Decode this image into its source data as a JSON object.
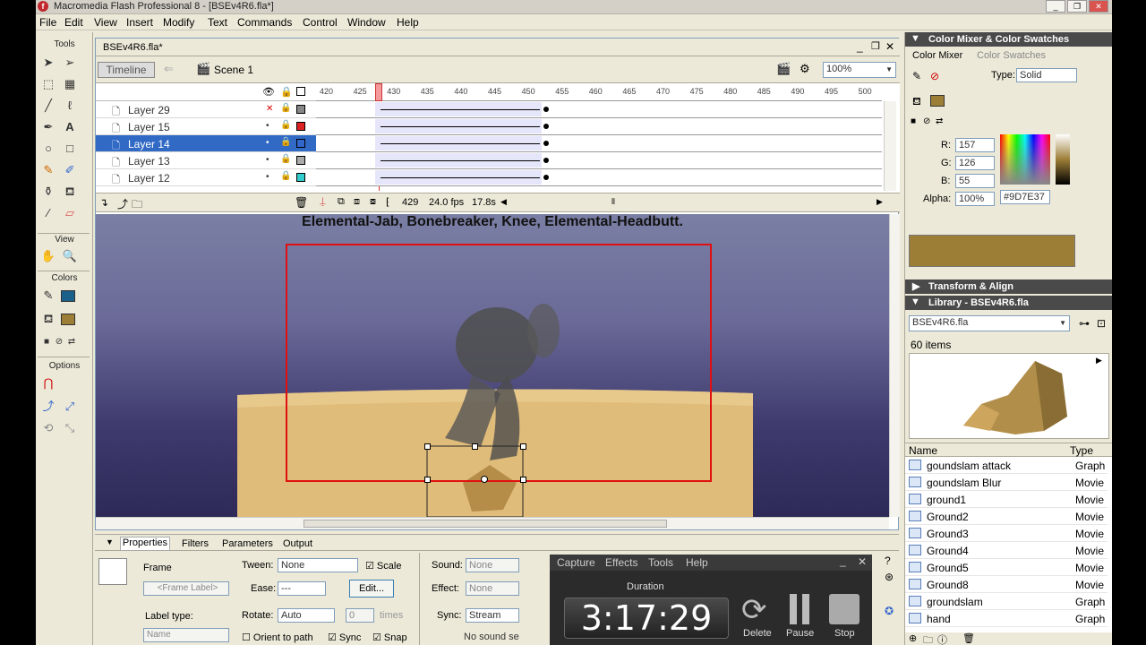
{
  "window": {
    "title": "Macromedia Flash Professional 8 - [BSEv4R6.fla*]"
  },
  "menu": [
    "File",
    "Edit",
    "View",
    "Insert",
    "Modify",
    "Text",
    "Commands",
    "Control",
    "Window",
    "Help"
  ],
  "tools_panel": {
    "title": "Tools",
    "view": "View",
    "colors": "Colors",
    "options": "Options"
  },
  "document": {
    "tab": "BSEv4R6.fla*",
    "timeline_button": "Timeline",
    "scene": "Scene 1",
    "zoom": "100%",
    "ruler": [
      "420",
      "425",
      "430",
      "435",
      "440",
      "445",
      "450",
      "455",
      "460",
      "465",
      "470",
      "475",
      "480",
      "485",
      "490",
      "495",
      "500"
    ],
    "layers": [
      {
        "name": "Layer 29",
        "selected": false
      },
      {
        "name": "Layer 15",
        "selected": false
      },
      {
        "name": "Layer 14",
        "selected": true
      },
      {
        "name": "Layer 13",
        "selected": false
      },
      {
        "name": "Layer 12",
        "selected": false
      }
    ],
    "frame": "429",
    "fps": "24.0 fps",
    "time": "17.8s",
    "stage_text": "Elemental-Jab, Bonebreaker, Knee, Elemental-Headbutt."
  },
  "properties": {
    "tabs": [
      "Properties",
      "Filters",
      "Parameters",
      "Output"
    ],
    "frame_label": "Frame",
    "frame_placeholder": "<Frame Label>",
    "label_type": "Label type:",
    "label_type_value": "Name",
    "tween_label": "Tween:",
    "tween_value": "None",
    "scale": "Scale",
    "ease_label": "Ease:",
    "ease_value": "---",
    "edit_button": "Edit...",
    "rotate_label": "Rotate:",
    "rotate_value": "Auto",
    "rotate_times": "0",
    "times": "times",
    "orient": "Orient to path",
    "sync": "Sync",
    "snap": "Snap",
    "sound_label": "Sound:",
    "sound_value": "None",
    "effect_label": "Effect:",
    "effect_value": "None",
    "sync_label": "Sync:",
    "sync_value": "Stream",
    "no_sound": "No sound se"
  },
  "capture": {
    "menu": [
      "Capture",
      "Effects",
      "Tools",
      "Help"
    ],
    "duration_label": "Duration",
    "duration": "3:17:29",
    "delete": "Delete",
    "pause": "Pause",
    "stop": "Stop"
  },
  "color_mixer": {
    "header": "Color Mixer & Color Swatches",
    "tab1": "Color Mixer",
    "tab2": "Color Swatches",
    "type_label": "Type:",
    "type_value": "Solid",
    "r_label": "R:",
    "r": "157",
    "g_label": "G:",
    "g": "126",
    "b_label": "B:",
    "b": "55",
    "alpha_label": "Alpha:",
    "alpha": "100%",
    "hex": "#9D7E37",
    "swatch_color": "#9D7E37"
  },
  "transform": {
    "header": "Transform & Align"
  },
  "library": {
    "header": "Library - BSEv4R6.fla",
    "file": "BSEv4R6.fla",
    "count": "60 items",
    "col_name": "Name",
    "col_type": "Type",
    "items": [
      {
        "name": "goundslam attack",
        "type": "Graph"
      },
      {
        "name": "goundslam Blur",
        "type": "Movie"
      },
      {
        "name": "ground1",
        "type": "Movie"
      },
      {
        "name": "Ground2",
        "type": "Movie"
      },
      {
        "name": "Ground3",
        "type": "Movie"
      },
      {
        "name": "Ground4",
        "type": "Movie"
      },
      {
        "name": "Ground5",
        "type": "Movie"
      },
      {
        "name": "Ground8",
        "type": "Movie"
      },
      {
        "name": "groundslam",
        "type": "Graph"
      },
      {
        "name": "hand",
        "type": "Graph"
      }
    ]
  }
}
